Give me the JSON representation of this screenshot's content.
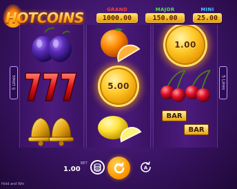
{
  "logo": {
    "text": "HOTCOINS"
  },
  "jackpots": {
    "grand": {
      "label": "GRAND",
      "value": "1000.00"
    },
    "major": {
      "label": "MAJOR",
      "value": "150.00"
    },
    "mini": {
      "label": "MINI",
      "value": "25.00"
    }
  },
  "lines": {
    "left_label": "5 Lines",
    "right_label": "5 Lines"
  },
  "reels": {
    "reel1": [
      "plums",
      "sevens",
      "bells"
    ],
    "reel2": [
      "oranges",
      "coin",
      "lemons"
    ],
    "reel3": [
      "coin",
      "cherries",
      "bars"
    ],
    "coin_values": {
      "reel2": "5.00",
      "reel3": "1.00"
    },
    "bar_text": "BAR"
  },
  "controls": {
    "bet_label": "BET",
    "bet_value": "1.00",
    "stack_icon": "coin-stack-icon",
    "spin_icon": "spin-arrow-icon",
    "autoplay_icon": "autoplay-icon"
  },
  "footer": {
    "text": "Hold and Win"
  },
  "colors": {
    "grand": "#ff3b3b",
    "major": "#4be04b",
    "mini": "#4ec3ff",
    "spin_button": "#ff9a00"
  }
}
